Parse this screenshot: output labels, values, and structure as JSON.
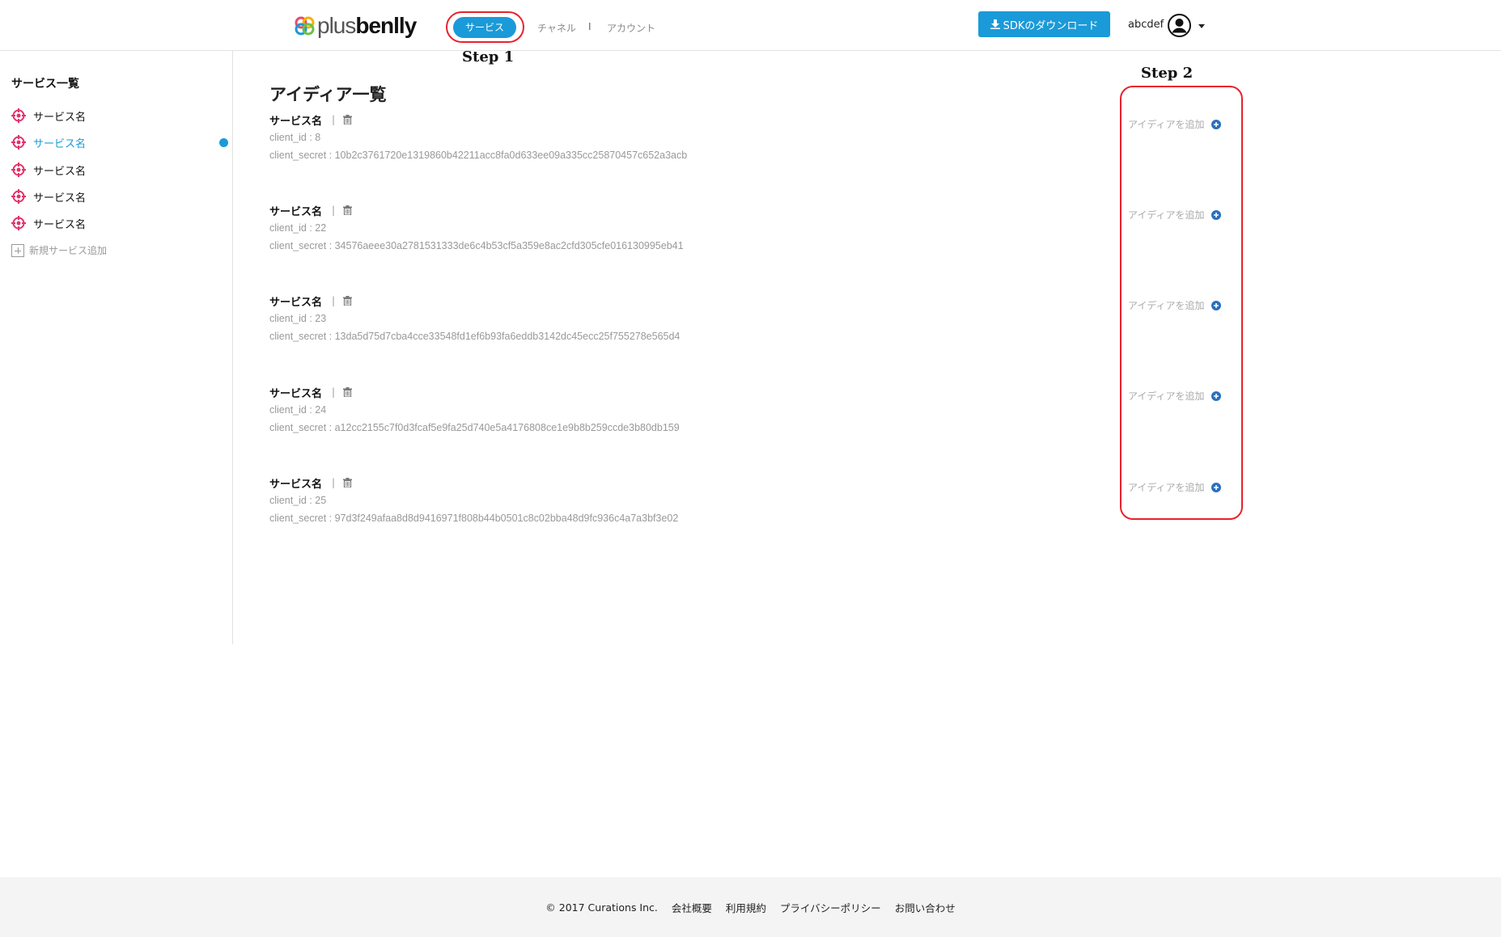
{
  "header": {
    "logo_plus": "plus",
    "logo_benlly": "benlly",
    "nav": {
      "service": "サービス",
      "channel": "チャネル",
      "separator": "I",
      "account": "アカウント"
    },
    "sdk_button": "SDKのダウンロード",
    "username": "abcdef"
  },
  "annotations": {
    "step1": "Step  1",
    "step2": "Step  2"
  },
  "sidebar": {
    "title": "サービス一覧",
    "items": [
      {
        "label": "サービス名",
        "active": false
      },
      {
        "label": "サービス名",
        "active": true
      },
      {
        "label": "サービス名",
        "active": false
      },
      {
        "label": "サービス名",
        "active": false
      },
      {
        "label": "サービス名",
        "active": false
      }
    ],
    "add_label": "新規サービス追加"
  },
  "main": {
    "title": "アイディア一覧",
    "pipe": "|",
    "add_idea_label": "アイディアを追加",
    "services": [
      {
        "name": "サービス名",
        "client_id": "client_id : 8",
        "client_secret": "client_secret : 10b2c3761720e1319860b42211acc8fa0d633ee09a335cc25870457c652a3acb"
      },
      {
        "name": "サービス名",
        "client_id": "client_id : 22",
        "client_secret": "client_secret : 34576aeee30a2781531333de6c4b53cf5a359e8ac2cfd305cfe016130995eb41"
      },
      {
        "name": "サービス名",
        "client_id": "client_id : 23",
        "client_secret": "client_secret : 13da5d75d7cba4cce33548fd1ef6b93fa6eddb3142dc45ecc25f755278e565d4"
      },
      {
        "name": "サービス名",
        "client_id": "client_id : 24",
        "client_secret": "client_secret : a12cc2155c7f0d3fcaf5e9fa25d740e5a4176808ce1e9b8b259ccde3b80db159"
      },
      {
        "name": "サービス名",
        "client_id": "client_id : 25",
        "client_secret": "client_secret : 97d3f249afaa8d8d9416971f808b44b0501c8c02bba48d9fc936c4a7a3bf3e02"
      }
    ]
  },
  "footer": {
    "copyright": "© 2017 Curations Inc.",
    "company": "会社概要",
    "terms": "利用規約",
    "privacy": "プライバシーポリシー",
    "contact": "お問い合わせ"
  },
  "colors": {
    "accent": "#1a9ad8",
    "annotation": "#e8222c",
    "service_icon": "#e2336b"
  }
}
